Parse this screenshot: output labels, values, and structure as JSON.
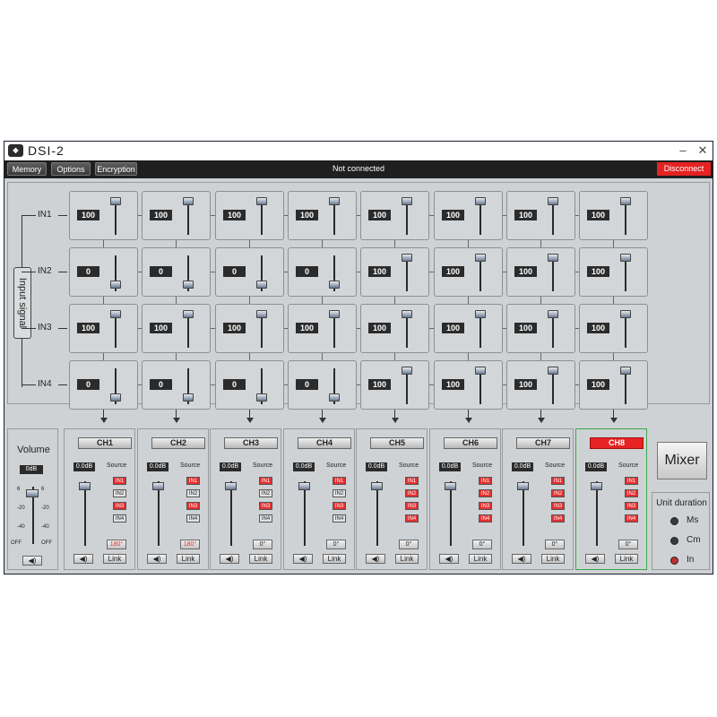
{
  "window": {
    "title": "DSI-2",
    "logo": "dsi",
    "minimize": "–",
    "close": "✕"
  },
  "menu": {
    "memory": "Memory",
    "options": "Options",
    "encryption": "Encryption",
    "status": "Not connected",
    "disconnect": "Disconnect"
  },
  "matrix": {
    "input_signal_label": "Input signal",
    "rows": [
      {
        "label": "IN1",
        "values": [
          "100",
          "100",
          "100",
          "100",
          "100",
          "100",
          "100",
          "100"
        ]
      },
      {
        "label": "IN2",
        "values": [
          "0",
          "0",
          "0",
          "0",
          "100",
          "100",
          "100",
          "100"
        ]
      },
      {
        "label": "IN3",
        "values": [
          "100",
          "100",
          "100",
          "100",
          "100",
          "100",
          "100",
          "100"
        ]
      },
      {
        "label": "IN4",
        "values": [
          "0",
          "0",
          "0",
          "0",
          "100",
          "100",
          "100",
          "100"
        ]
      }
    ]
  },
  "volume": {
    "title": "Volume",
    "value": "0dB",
    "scale_left": [
      "6",
      "-20",
      "-40",
      "OFF"
    ],
    "scale_right": [
      "6",
      "-20",
      "-40",
      "OFF"
    ],
    "mute_icon": "speaker-icon",
    "level": 0.95
  },
  "channels": [
    {
      "name": "CH1",
      "gain": "0.0dB",
      "source_label": "Source",
      "sources": [
        "IN1",
        "IN2",
        "IN3",
        "IN4"
      ],
      "active": [
        true,
        false,
        true,
        false
      ],
      "phase": "180°",
      "phase_red": true,
      "link": "Link",
      "level": 0.95,
      "selected": false
    },
    {
      "name": "CH2",
      "gain": "0.0dB",
      "source_label": "Source",
      "sources": [
        "IN1",
        "IN2",
        "IN3",
        "IN4"
      ],
      "active": [
        true,
        false,
        true,
        false
      ],
      "phase": "180°",
      "phase_red": true,
      "link": "Link",
      "level": 0.95,
      "selected": false
    },
    {
      "name": "CH3",
      "gain": "0.0dB",
      "source_label": "Source",
      "sources": [
        "IN1",
        "IN2",
        "IN3",
        "IN4"
      ],
      "active": [
        true,
        false,
        true,
        false
      ],
      "phase": "0°",
      "phase_red": false,
      "link": "Link",
      "level": 0.95,
      "selected": false
    },
    {
      "name": "CH4",
      "gain": "0.0dB",
      "source_label": "Source",
      "sources": [
        "IN1",
        "IN2",
        "IN3",
        "IN4"
      ],
      "active": [
        true,
        false,
        true,
        false
      ],
      "phase": "0°",
      "phase_red": false,
      "link": "Link",
      "level": 0.95,
      "selected": false
    },
    {
      "name": "CH5",
      "gain": "0.0dB",
      "source_label": "Source",
      "sources": [
        "IN1",
        "IN2",
        "IN3",
        "IN4"
      ],
      "active": [
        true,
        true,
        true,
        true
      ],
      "phase": "0°",
      "phase_red": false,
      "link": "Link",
      "level": 0.95,
      "selected": false
    },
    {
      "name": "CH6",
      "gain": "0.0dB",
      "source_label": "Source",
      "sources": [
        "IN1",
        "IN2",
        "IN3",
        "IN4"
      ],
      "active": [
        true,
        true,
        true,
        true
      ],
      "phase": "0°",
      "phase_red": false,
      "link": "Link",
      "level": 0.95,
      "selected": false
    },
    {
      "name": "CH7",
      "gain": "0.0dB",
      "source_label": "Source",
      "sources": [
        "IN1",
        "IN2",
        "IN3",
        "IN4"
      ],
      "active": [
        true,
        true,
        true,
        true
      ],
      "phase": "0°",
      "phase_red": false,
      "link": "Link",
      "level": 0.95,
      "selected": false
    },
    {
      "name": "CH8",
      "gain": "0.0dB",
      "source_label": "Source",
      "sources": [
        "IN1",
        "IN2",
        "IN3",
        "IN4"
      ],
      "active": [
        true,
        true,
        true,
        true
      ],
      "phase": "0°",
      "phase_red": false,
      "link": "Link",
      "level": 0.95,
      "selected": true
    }
  ],
  "mixer": {
    "label": "Mixer"
  },
  "unit_duration": {
    "title": "Unit duration",
    "options": [
      "Ms",
      "Cm",
      "In"
    ],
    "selected": "In"
  }
}
